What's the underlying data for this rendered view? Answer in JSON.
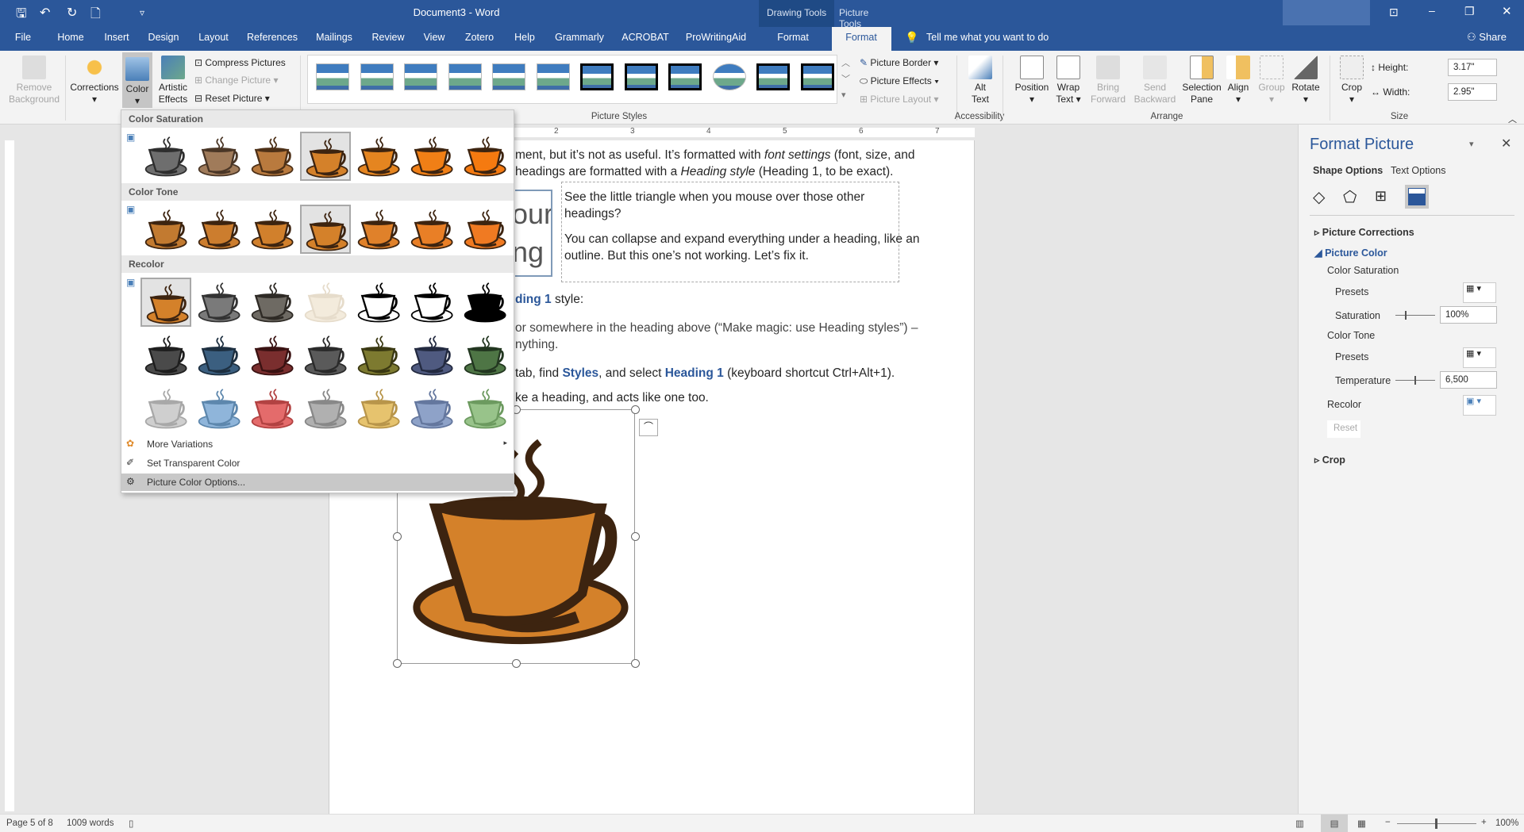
{
  "window": {
    "title": "Document3 - Word",
    "context_groups": [
      "Drawing Tools",
      "Picture Tools"
    ]
  },
  "qat": {
    "save": "💾",
    "undo": "↶",
    "redo": "↻",
    "new": "🗋",
    "customize": "▿"
  },
  "tabs": [
    "File",
    "Home",
    "Insert",
    "Design",
    "Layout",
    "References",
    "Mailings",
    "Review",
    "View",
    "Zotero",
    "Help",
    "Grammarly",
    "ACROBAT",
    "ProWritingAid",
    "Format",
    "Format"
  ],
  "active_tab_index": 15,
  "tell_me": "Tell me what you want to do",
  "share": "Share",
  "ribbon": {
    "remove_background": [
      "Remove",
      "Background"
    ],
    "corrections": "Corrections",
    "color": "Color",
    "artistic_effects": [
      "Artistic",
      "Effects"
    ],
    "compress": "Compress Pictures",
    "change": "Change Picture",
    "reset": "Reset Picture",
    "picture_styles_label": "Picture Styles",
    "border": "Picture Border",
    "effects": "Picture Effects",
    "layout": "Picture Layout",
    "alt_text": [
      "Alt",
      "Text"
    ],
    "accessibility_label": "Accessibility",
    "position": "Position",
    "wrap_text": [
      "Wrap",
      "Text"
    ],
    "bring_forward": [
      "Bring",
      "Forward"
    ],
    "send_backward": [
      "Send",
      "Backward"
    ],
    "selection_pane": [
      "Selection",
      "Pane"
    ],
    "align": "Align",
    "group": "Group",
    "rotate": "Rotate",
    "arrange_label": "Arrange",
    "crop": "Crop",
    "height_label": "Height:",
    "height_value": "3.17\"",
    "width_label": "Width:",
    "width_value": "2.95\"",
    "size_label": "Size"
  },
  "ruler_numbers": [
    "2",
    "3",
    "4",
    "5",
    "6",
    "7"
  ],
  "document": {
    "line1a": "ment, but it’s not as useful. It’s formatted with ",
    "line1b": "font settings",
    "line1c": " (font, size, and",
    "line2a": " headings are formatted with a ",
    "line2b": "Heading style",
    "line2c": " (Heading 1, to be exact).",
    "img_text1": "our",
    "img_text2": "ng",
    "tb1": "See the little triangle when you mouse over those other",
    "tb2": "headings?",
    "tb3": "You can collapse and expand everything under a heading, like an",
    "tb4": "outline. But this one’s not working. Let’s fix it.",
    "l3a": "ding 1",
    "l3b": " style:",
    "l4": "or somewhere in the heading above (“Make magic: use Heading styles”) –",
    "l5": "nything.",
    "l6a": "tab, find ",
    "l6b": "Styles",
    "l6c": ", and select ",
    "l6d": "Heading 1",
    "l6e": " (keyboard shortcut Ctrl+Alt+1).",
    "l7": "ke a heading, and acts like one too."
  },
  "color_menu": {
    "saturation_label": "Color Saturation",
    "tone_label": "Color Tone",
    "recolor_label": "Recolor",
    "saturation": [
      [
        "#6e6e6e",
        "#2e2e2e"
      ],
      [
        "#a07b5a",
        "#4a3626"
      ],
      [
        "#b97a3e",
        "#4d3017"
      ],
      [
        "#d4812a",
        "#3d2410"
      ],
      [
        "#e58520",
        "#3d2410"
      ],
      [
        "#f07f16",
        "#3d2410"
      ],
      [
        "#f57a10",
        "#3d2410"
      ]
    ],
    "saturation_selected": 3,
    "tone": [
      [
        "#c27a30",
        "#3d2410"
      ],
      [
        "#cc7d2e",
        "#3d2410"
      ],
      [
        "#d1802c",
        "#3d2410"
      ],
      [
        "#d4812a",
        "#3d2410"
      ],
      [
        "#e0812a",
        "#3d2410"
      ],
      [
        "#e97f26",
        "#3d2410"
      ],
      [
        "#f07a22",
        "#3d2410"
      ]
    ],
    "tone_selected": 3,
    "recolor": [
      [
        [
          "#d4812a",
          "#3d2410"
        ],
        [
          "#7a7a7a",
          "#333333"
        ],
        [
          "#6e6a63",
          "#2e2a25"
        ],
        [
          "#f3ebdc",
          "#e6dccb"
        ],
        [
          "#ffffff",
          "#000000"
        ],
        [
          "#ffffff",
          "#000000"
        ],
        [
          "#000000",
          "#000000"
        ]
      ],
      [
        [
          "#4a4a4a",
          "#1e1e1e"
        ],
        [
          "#3b5f80",
          "#1d2f40"
        ],
        [
          "#7a2e2e",
          "#3a1212"
        ],
        [
          "#5a5a5a",
          "#2a2a2a"
        ],
        [
          "#7d7a30",
          "#3a3812"
        ],
        [
          "#4f5a80",
          "#232a40"
        ],
        [
          "#4e7545",
          "#223620"
        ]
      ],
      [
        [
          "#cfcfcf",
          "#a8a8a8"
        ],
        [
          "#8fb5da",
          "#5d87ad"
        ],
        [
          "#e46b6b",
          "#b24242"
        ],
        [
          "#b0b0b0",
          "#888888"
        ],
        [
          "#e6c36e",
          "#b8954a"
        ],
        [
          "#8ea2c8",
          "#64779e"
        ],
        [
          "#98c38a",
          "#6c9a5f"
        ]
      ]
    ],
    "recolor_selected": 0,
    "more_variations": "More Variations",
    "set_transparent": "Set Transparent Color",
    "options": "Picture Color Options..."
  },
  "main_image_colors": [
    "#d4812a",
    "#3d2410"
  ],
  "pane": {
    "title": "Format Picture",
    "shape_options": "Shape Options",
    "text_options": "Text Options",
    "picture_corrections": "Picture Corrections",
    "picture_color": "Picture Color",
    "color_saturation": "Color Saturation",
    "presets": "Presets",
    "saturation": "Saturation",
    "saturation_value": "100%",
    "color_tone": "Color Tone",
    "presets2": "Presets",
    "temperature": "Temperature",
    "temperature_value": "6,500",
    "recolor": "Recolor",
    "reset": "Reset",
    "crop": "Crop"
  },
  "status": {
    "page": "Page 5 of 8",
    "words": "1009 words",
    "zoom": "100%"
  }
}
